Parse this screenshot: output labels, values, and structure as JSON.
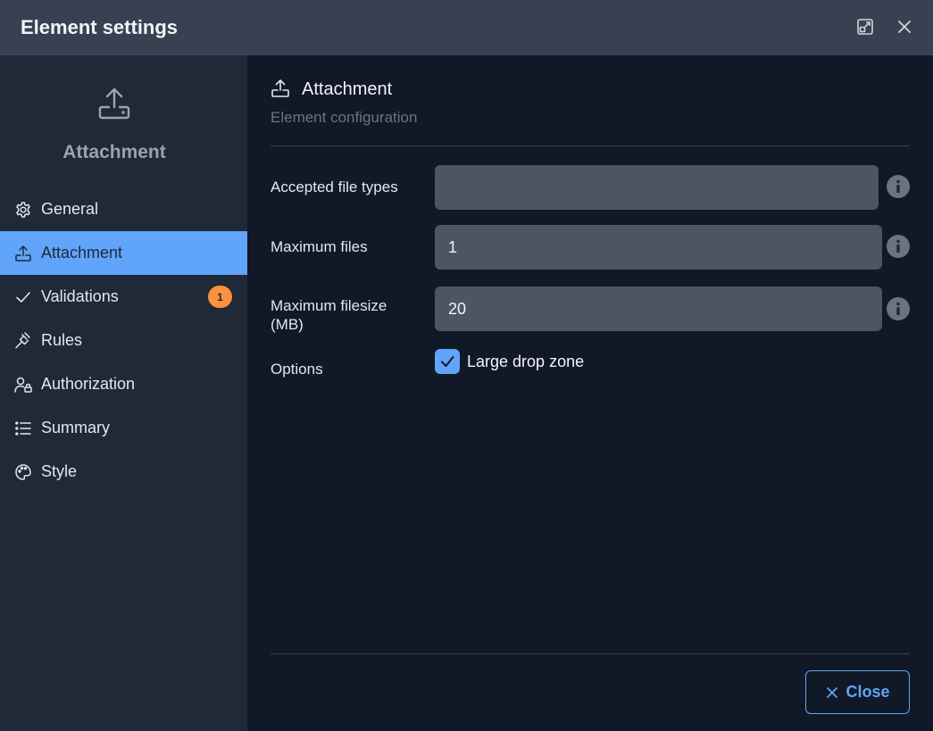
{
  "window": {
    "title": "Element settings",
    "maximize_icon": "expand-icon",
    "close_icon": "close-icon"
  },
  "sidebar": {
    "icon": "upload-tray-icon",
    "title": "Attachment",
    "items": [
      {
        "label": "General",
        "icon": "gear-icon"
      },
      {
        "label": "Attachment",
        "icon": "upload-tray-icon",
        "active": true
      },
      {
        "label": "Validations",
        "icon": "check-icon",
        "badge": "1"
      },
      {
        "label": "Rules",
        "icon": "gavel-icon"
      },
      {
        "label": "Authorization",
        "icon": "user-lock-icon"
      },
      {
        "label": "Summary",
        "icon": "list-icon"
      },
      {
        "label": "Style",
        "icon": "palette-icon"
      }
    ]
  },
  "main": {
    "header": {
      "icon": "upload-tray-icon",
      "title": "Attachment",
      "subtitle": "Element configuration"
    },
    "fields": {
      "accepted_types": {
        "label": "Accepted file types",
        "value": ""
      },
      "max_files": {
        "label": "Maximum files",
        "value": "1"
      },
      "max_filesize": {
        "label": "Maximum filesize (MB)",
        "value": "20"
      }
    },
    "options": {
      "label": "Options",
      "large_drop_zone": {
        "label": "Large drop zone",
        "checked": true
      }
    },
    "footer": {
      "close_label": "Close"
    }
  },
  "colors": {
    "accent": "#60a5fa",
    "badge": "#fb923c",
    "titlebar": "#374151",
    "sidebar": "#1f2937",
    "background": "#111827",
    "input": "#4b5563"
  }
}
